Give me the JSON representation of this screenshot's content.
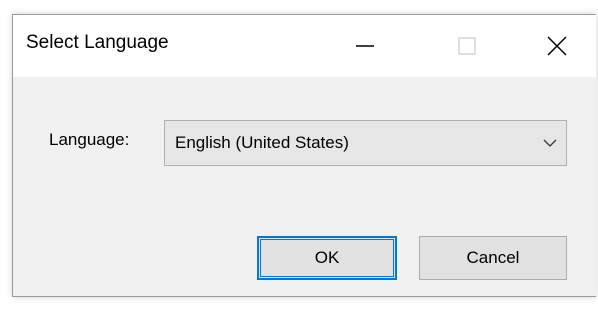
{
  "window": {
    "title": "Select Language"
  },
  "titlebar": {
    "minimize_icon": "minimize-icon",
    "maximize_icon": "maximize-icon",
    "close_icon": "close-icon"
  },
  "form": {
    "language_label": "Language:",
    "language_value": "English (United States)",
    "dropdown_icon": "chevron-down-icon"
  },
  "buttons": {
    "ok_label": "OK",
    "cancel_label": "Cancel"
  },
  "colors": {
    "accent": "#0078d7",
    "dialog_bg": "#f0f0f0",
    "titlebar_bg": "#ffffff"
  }
}
